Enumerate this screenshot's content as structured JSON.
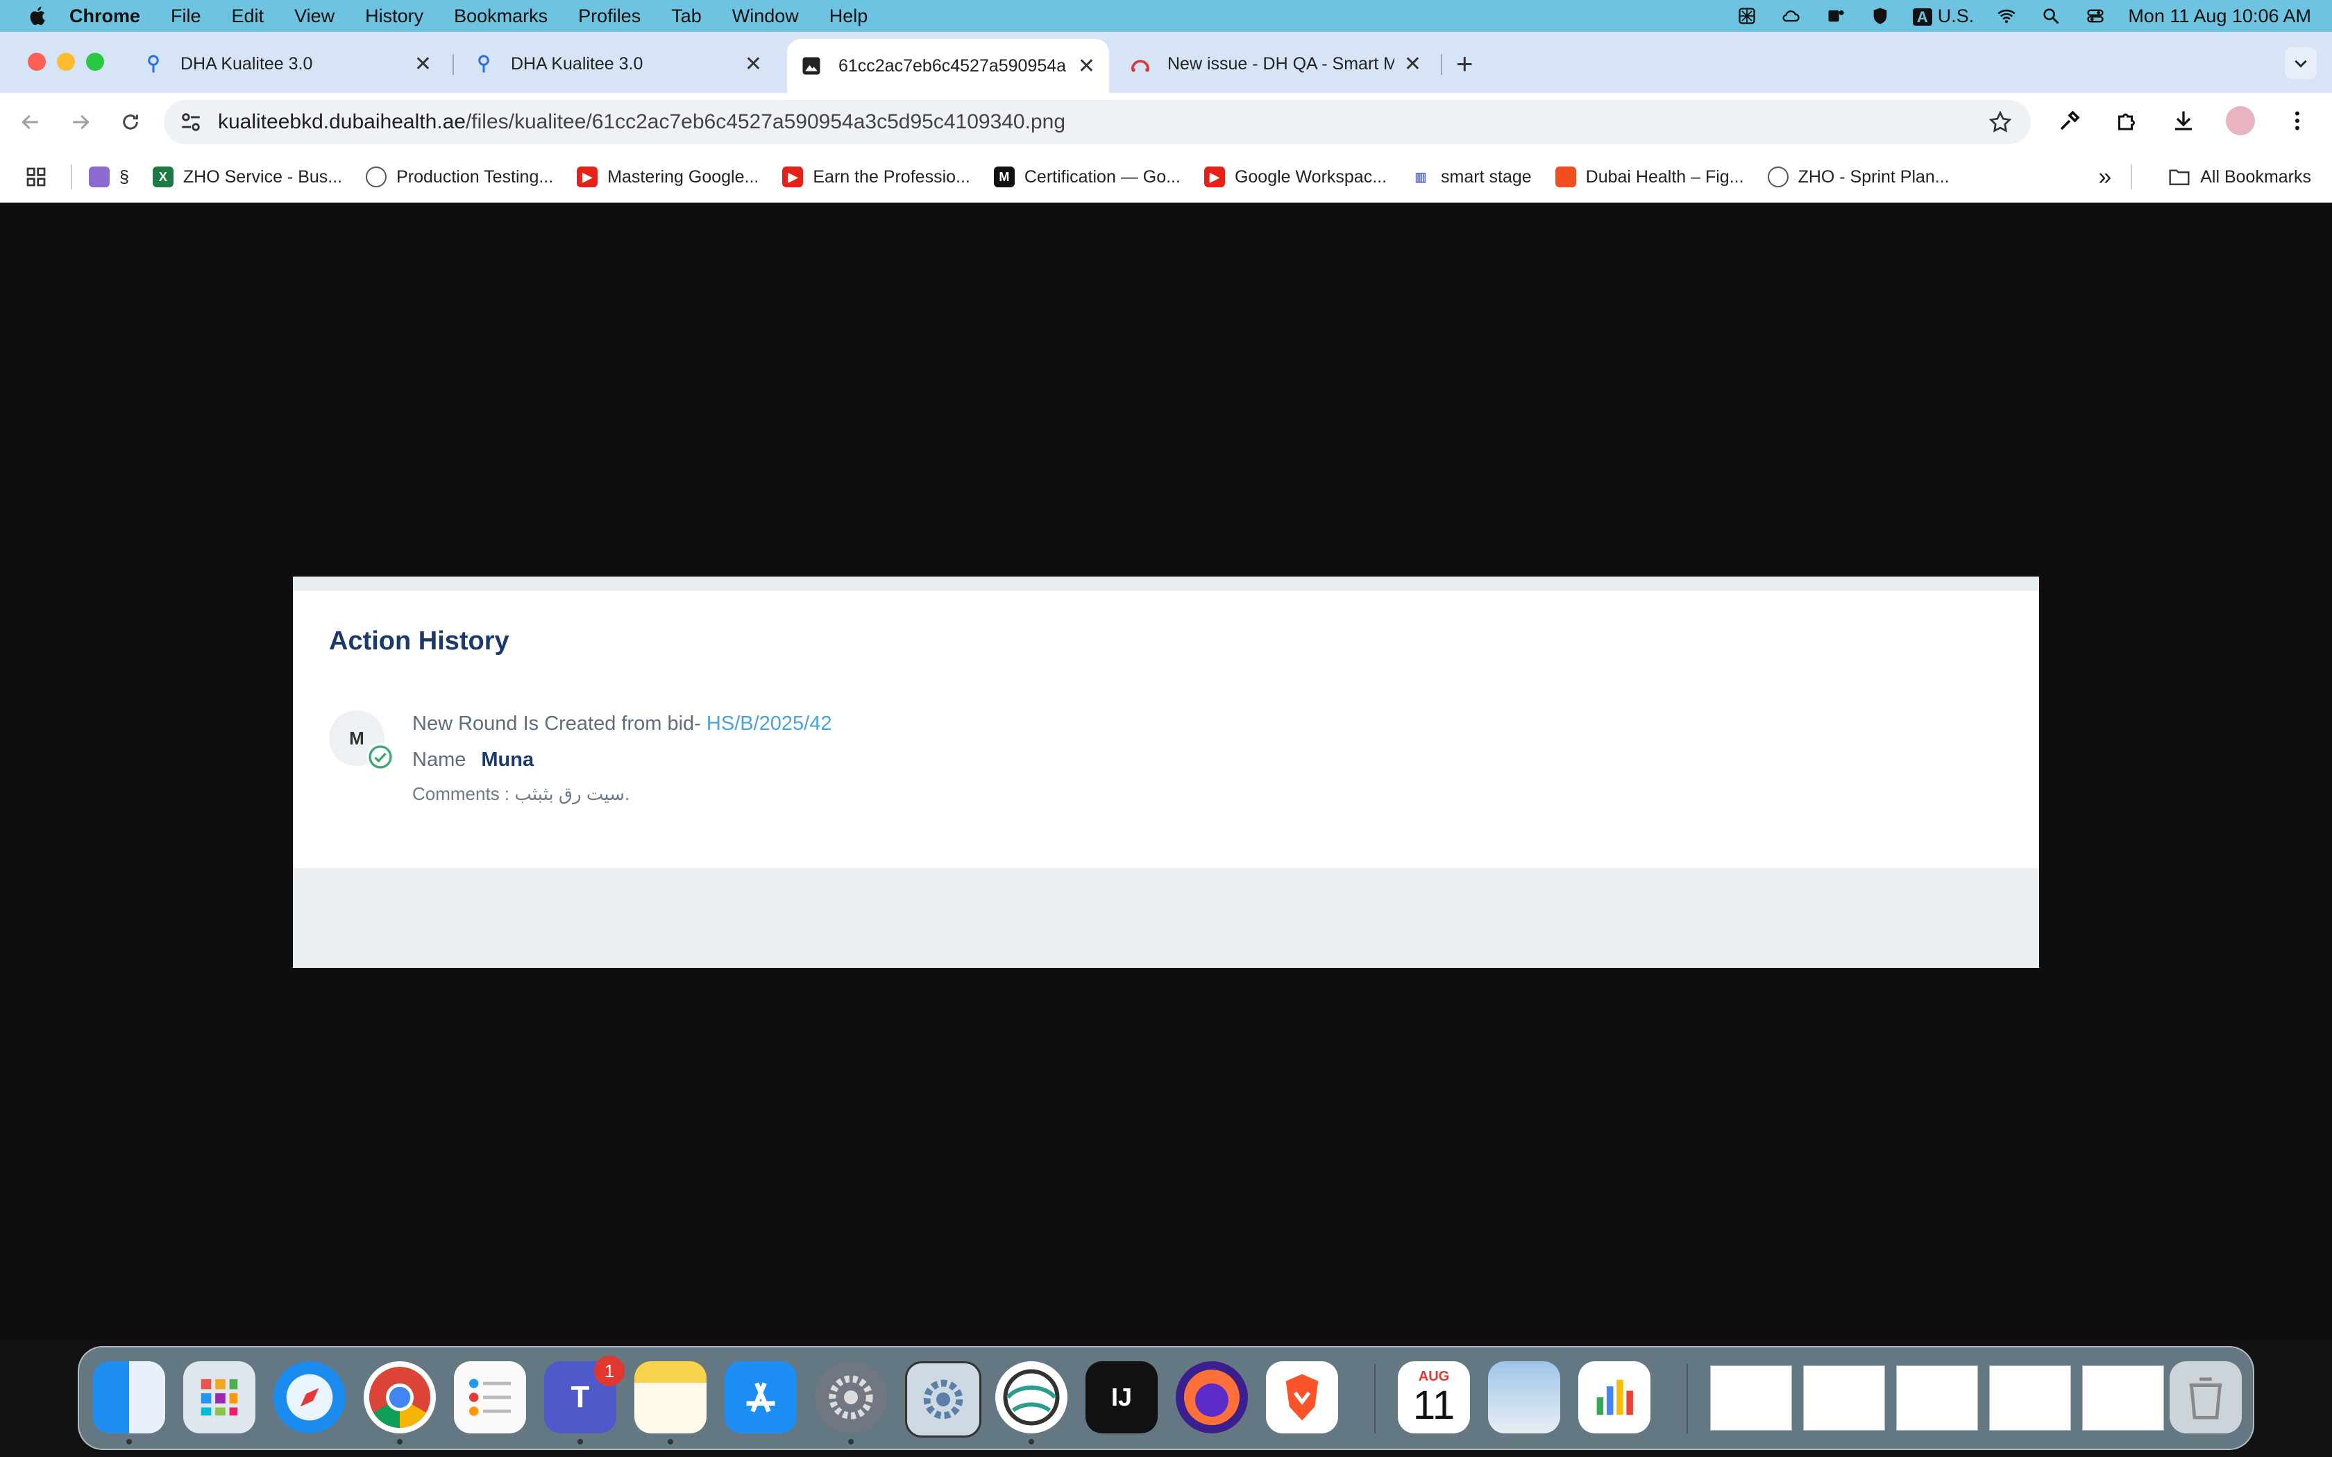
{
  "menubar": {
    "app": "Chrome",
    "items": [
      "File",
      "Edit",
      "View",
      "History",
      "Bookmarks",
      "Profiles",
      "Tab",
      "Window",
      "Help"
    ],
    "input_source": "U.S.",
    "input_badge": "A",
    "datetime": "Mon 11 Aug  10:06 AM"
  },
  "tabs": [
    {
      "label": "DHA Kualitee 3.0",
      "close": "✕"
    },
    {
      "label": "DHA Kualitee 3.0",
      "close": "✕"
    },
    {
      "label": "61cc2ac7eb6c4527a590954a",
      "close": "✕"
    },
    {
      "label": "New issue - DH QA - Smart M",
      "close": "✕"
    }
  ],
  "new_tab": "+",
  "address": {
    "host": "kualiteebkd.dubaihealth.ae",
    "path": "/files/kualitee/61cc2ac7eb6c4527a590954a3c5d95c4109340.png"
  },
  "bookmarks": {
    "items": [
      {
        "label": "§"
      },
      {
        "label": "ZHO Service - Bus..."
      },
      {
        "label": "Production Testing..."
      },
      {
        "label": "Mastering Google..."
      },
      {
        "label": "Earn the Professio..."
      },
      {
        "label": "Certification — Go..."
      },
      {
        "label": "Google Workspac..."
      },
      {
        "label": "smart stage"
      },
      {
        "label": "Dubai Health – Fig..."
      },
      {
        "label": "ZHO - Sprint Plan..."
      }
    ],
    "overflow": "»",
    "all_bookmarks": "All Bookmarks"
  },
  "card": {
    "title": "Action History",
    "avatar_initial": "M",
    "entry_text": "New Round Is Created from bid-",
    "entry_link": "HS/B/2025/42",
    "name_label": "Name",
    "name_value": "Muna",
    "comments": "Comments : سيت رق بثبثب."
  },
  "dock": {
    "teams_badge": "1",
    "calendar_month": "AUG",
    "calendar_day": "11",
    "intellij_label": "IJ"
  }
}
